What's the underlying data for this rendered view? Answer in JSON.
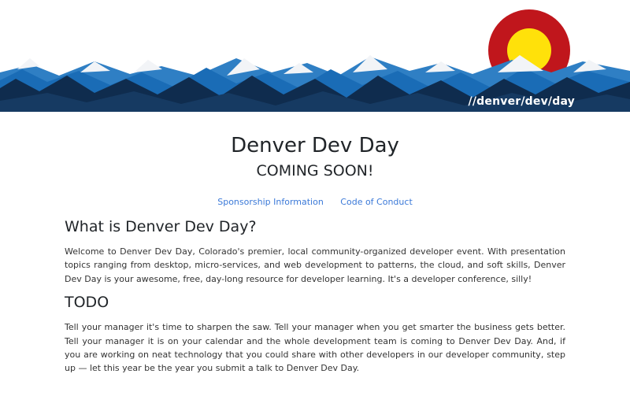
{
  "banner": {
    "tag": "//denver/dev/day"
  },
  "hero": {
    "title": "Denver Dev Day",
    "subtitle": "COMING SOON!"
  },
  "links": {
    "sponsorship": "Sponsorship Information",
    "conduct": "Code of Conduct"
  },
  "sections": {
    "what": {
      "heading": "What is Denver Dev Day?",
      "body": "Welcome to Denver Dev Day, Colorado's premier, local community-organized developer event. With presentation topics ranging from desktop, micro-services, and web development to patterns, the cloud, and soft skills, Denver Dev Day is your awesome, free, day-long resource for developer learning. It's a developer conference, silly!"
    },
    "todo": {
      "heading": "TODO",
      "body": "Tell your manager it's time to sharpen the saw. Tell your manager when you get smarter the business gets better. Tell your manager it is on your calendar and the whole development team is coming to Denver Dev Day. And, if you are working on neat technology that you could share with other developers in our developer community, step up — let this year be the year you submit a talk to Denver Dev Day."
    }
  },
  "colors": {
    "navy": "#0f2c4e",
    "blue": "#1a6cb6",
    "snow": "#f2f4f7",
    "sun_red": "#c0161c",
    "sun_yellow": "#ffe10a",
    "link": "#3b79d8"
  }
}
